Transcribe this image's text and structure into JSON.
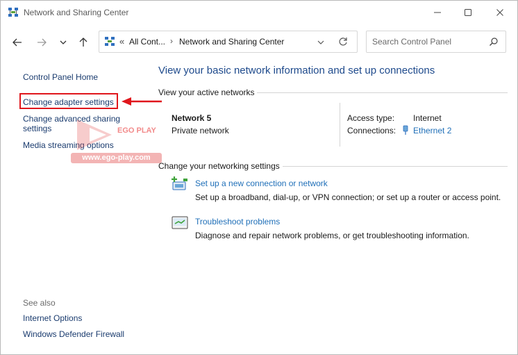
{
  "window": {
    "title": "Network and Sharing Center",
    "controls": {
      "minimize": "minimize",
      "maximize": "maximize",
      "close": "close"
    }
  },
  "nav": {
    "address": {
      "overflow": "«",
      "crumbs": [
        "All Cont...",
        "Network and Sharing Center"
      ],
      "separator": "›"
    },
    "search": {
      "placeholder": "Search Control Panel",
      "value": ""
    }
  },
  "sidebar": {
    "links": [
      "Control Panel Home",
      "Change adapter settings",
      "Change advanced sharing settings",
      "Media streaming options"
    ],
    "see_also_title": "See also",
    "see_also_links": [
      "Internet Options",
      "Windows Defender Firewall"
    ]
  },
  "watermark": {
    "brand": "EGO PLAY",
    "url": "www.ego-play.com"
  },
  "main": {
    "heading": "View your basic network information and set up connections",
    "active_networks": {
      "title": "View your active networks",
      "network_name": "Network 5",
      "network_type": "Private network",
      "access_type_label": "Access type:",
      "access_type_value": "Internet",
      "connections_label": "Connections:",
      "connection_link": "Ethernet 2"
    },
    "settings": {
      "title": "Change your networking settings",
      "tasks": [
        {
          "link": "Set up a new connection or network",
          "desc": "Set up a broadband, dial-up, or VPN connection; or set up a router or access point."
        },
        {
          "link": "Troubleshoot problems",
          "desc": "Diagnose and repair network problems, or get troubleshooting information."
        }
      ]
    }
  },
  "colors": {
    "link": "#1f6fb8",
    "heading": "#1e4a8c",
    "highlight": "#e0161c"
  }
}
